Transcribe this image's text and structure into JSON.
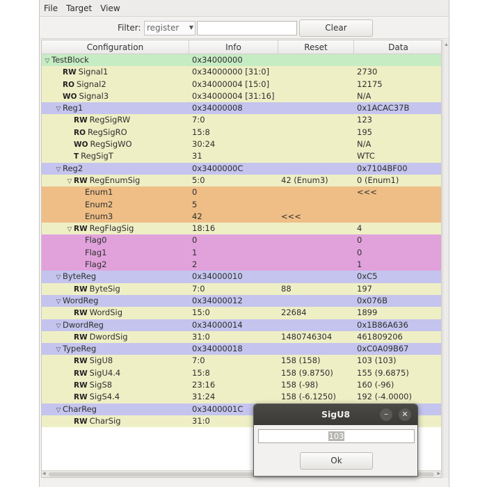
{
  "menu": {
    "file": "File",
    "target": "Target",
    "view": "View"
  },
  "filter": {
    "label": "Filter:",
    "combo_value": "register",
    "input_value": "",
    "clear_label": "Clear"
  },
  "columns": [
    "Configuration",
    "Info",
    "Reset",
    "Data"
  ],
  "rows": [
    {
      "bg": "green",
      "indent": 0,
      "exp": "▽",
      "acc": "",
      "name": "TestBlock",
      "info": "0x34000000",
      "reset": "",
      "data": ""
    },
    {
      "bg": "yellow",
      "indent": 1,
      "exp": "",
      "acc": "RW",
      "name": "Signal1",
      "info": "0x34000000 [31:0]",
      "reset": "",
      "data": "2730"
    },
    {
      "bg": "yellow",
      "indent": 1,
      "exp": "",
      "acc": "RO",
      "name": "Signal2",
      "info": "0x34000004 [15:0]",
      "reset": "",
      "data": "12175"
    },
    {
      "bg": "yellow",
      "indent": 1,
      "exp": "",
      "acc": "WO",
      "name": "Signal3",
      "info": "0x34000004 [31:16]",
      "reset": "",
      "data": "N/A"
    },
    {
      "bg": "purple",
      "indent": 1,
      "exp": "▽",
      "acc": "",
      "name": "Reg1",
      "info": "0x34000008",
      "reset": "",
      "data": "0x1ACAC37B"
    },
    {
      "bg": "yellow",
      "indent": 2,
      "exp": "",
      "acc": "RW",
      "name": "RegSigRW",
      "info": "7:0",
      "reset": "",
      "data": "123"
    },
    {
      "bg": "yellow",
      "indent": 2,
      "exp": "",
      "acc": "RO",
      "name": "RegSigRO",
      "info": "15:8",
      "reset": "",
      "data": "195"
    },
    {
      "bg": "yellow",
      "indent": 2,
      "exp": "",
      "acc": "WO",
      "name": "RegSigWO",
      "info": "30:24",
      "reset": "",
      "data": "N/A"
    },
    {
      "bg": "yellow",
      "indent": 2,
      "exp": "",
      "acc": "T",
      "name": "RegSigT",
      "info": "31",
      "reset": "",
      "data": "WTC"
    },
    {
      "bg": "purple",
      "indent": 1,
      "exp": "▽",
      "acc": "",
      "name": "Reg2",
      "info": "0x3400000C",
      "reset": "",
      "data": "0x7104BF00"
    },
    {
      "bg": "yellow",
      "indent": 2,
      "exp": "▽",
      "acc": "RW",
      "name": "RegEnumSig",
      "info": "5:0",
      "reset": "42 (Enum3)",
      "data": "0 (Enum1)"
    },
    {
      "bg": "orange",
      "indent": 3,
      "exp": "",
      "acc": "",
      "name": "Enum1",
      "info": "0",
      "reset": "",
      "data": "<<<"
    },
    {
      "bg": "orange",
      "indent": 3,
      "exp": "",
      "acc": "",
      "name": "Enum2",
      "info": "5",
      "reset": "",
      "data": ""
    },
    {
      "bg": "orange",
      "indent": 3,
      "exp": "",
      "acc": "",
      "name": "Enum3",
      "info": "42",
      "reset": "<<<",
      "data": ""
    },
    {
      "bg": "yellow",
      "indent": 2,
      "exp": "▽",
      "acc": "RW",
      "name": "RegFlagSig",
      "info": "18:16",
      "reset": "",
      "data": "4"
    },
    {
      "bg": "pink",
      "indent": 3,
      "exp": "",
      "acc": "",
      "name": "Flag0",
      "info": "0",
      "reset": "",
      "data": "0"
    },
    {
      "bg": "pink",
      "indent": 3,
      "exp": "",
      "acc": "",
      "name": "Flag1",
      "info": "1",
      "reset": "",
      "data": "0"
    },
    {
      "bg": "pink",
      "indent": 3,
      "exp": "",
      "acc": "",
      "name": "Flag2",
      "info": "2",
      "reset": "",
      "data": "1"
    },
    {
      "bg": "purple",
      "indent": 1,
      "exp": "▽",
      "acc": "",
      "name": "ByteReg",
      "info": "0x34000010",
      "reset": "",
      "data": "0xC5"
    },
    {
      "bg": "yellow",
      "indent": 2,
      "exp": "",
      "acc": "RW",
      "name": "ByteSig",
      "info": "7:0",
      "reset": "88",
      "data": "197"
    },
    {
      "bg": "purple",
      "indent": 1,
      "exp": "▽",
      "acc": "",
      "name": "WordReg",
      "info": "0x34000012",
      "reset": "",
      "data": "0x076B"
    },
    {
      "bg": "yellow",
      "indent": 2,
      "exp": "",
      "acc": "RW",
      "name": "WordSig",
      "info": "15:0",
      "reset": "22684",
      "data": "1899"
    },
    {
      "bg": "purple",
      "indent": 1,
      "exp": "▽",
      "acc": "",
      "name": "DwordReg",
      "info": "0x34000014",
      "reset": "",
      "data": "0x1B86A636"
    },
    {
      "bg": "yellow",
      "indent": 2,
      "exp": "",
      "acc": "RW",
      "name": "DwordSig",
      "info": "31:0",
      "reset": "1480746304",
      "data": "461809206"
    },
    {
      "bg": "purple",
      "indent": 1,
      "exp": "▽",
      "acc": "",
      "name": "TypeReg",
      "info": "0x34000018",
      "reset": "",
      "data": "0xC0A09B67"
    },
    {
      "bg": "yellow",
      "indent": 2,
      "exp": "",
      "acc": "RW",
      "name": "SigU8",
      "info": "7:0",
      "reset": "158 (158)",
      "data": "103 (103)"
    },
    {
      "bg": "yellow",
      "indent": 2,
      "exp": "",
      "acc": "RW",
      "name": "SigU4.4",
      "info": "15:8",
      "reset": "158 (9.8750)",
      "data": "155 (9.6875)"
    },
    {
      "bg": "yellow",
      "indent": 2,
      "exp": "",
      "acc": "RW",
      "name": "SigS8",
      "info": "23:16",
      "reset": "158 (-98)",
      "data": "160 (-96)"
    },
    {
      "bg": "yellow",
      "indent": 2,
      "exp": "",
      "acc": "RW",
      "name": "SigS4.4",
      "info": "31:24",
      "reset": "158 (-6.1250)",
      "data": "192 (-4.0000)"
    },
    {
      "bg": "purple",
      "indent": 1,
      "exp": "▽",
      "acc": "",
      "name": "CharReg",
      "info": "0x3400001C",
      "reset": "",
      "data": ""
    },
    {
      "bg": "yellow",
      "indent": 2,
      "exp": "",
      "acc": "RW",
      "name": "CharSig",
      "info": "31:0",
      "reset": "",
      "data": ""
    }
  ],
  "dialog": {
    "title": "SigU8",
    "value": "103",
    "ok_label": "Ok",
    "minimize": "–",
    "close": "✕"
  }
}
